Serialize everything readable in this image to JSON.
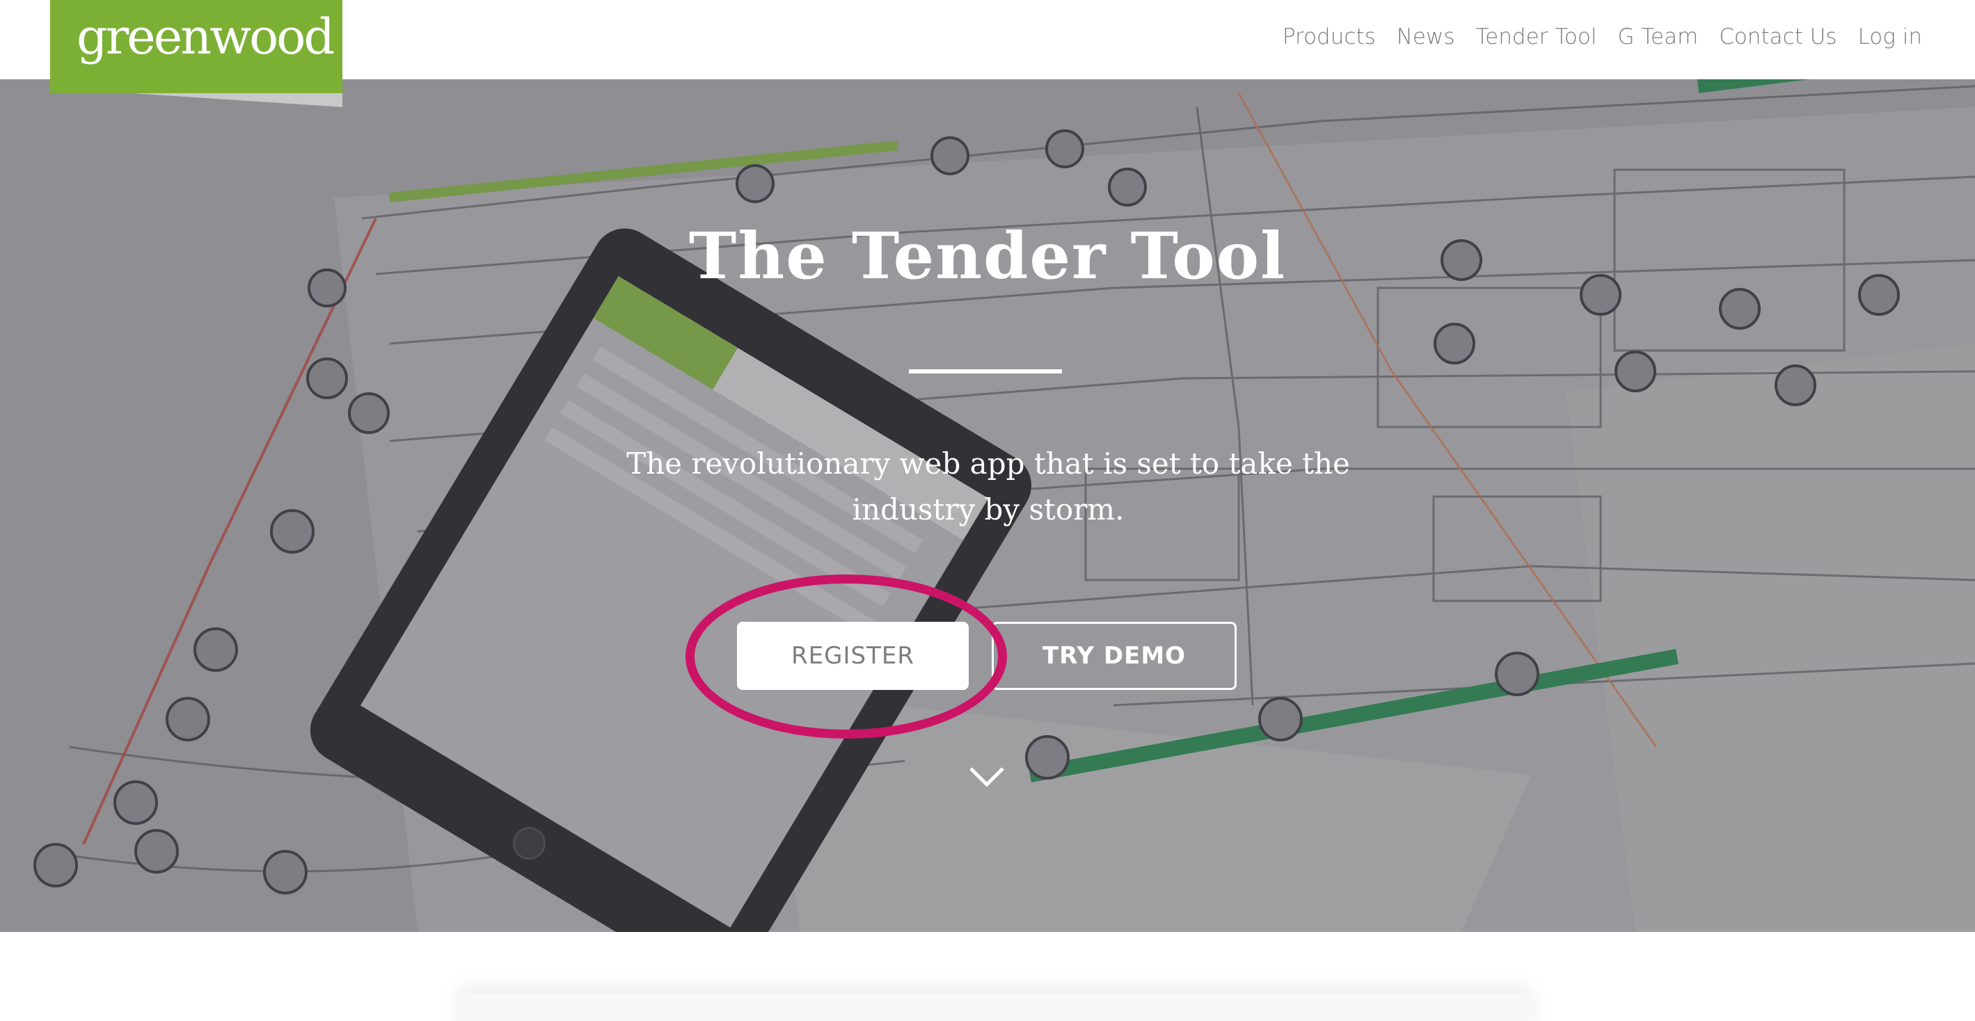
{
  "brand": {
    "logo_text": "greenwood",
    "color": "#7cb035"
  },
  "nav": {
    "items": [
      {
        "label": "Products"
      },
      {
        "label": "News"
      },
      {
        "label": "Tender Tool"
      },
      {
        "label": "G Team"
      },
      {
        "label": "Contact Us"
      },
      {
        "label": "Log in"
      }
    ]
  },
  "hero": {
    "title": "The Tender Tool",
    "subtitle": "The revolutionary web app that is set to take the industry by storm.",
    "register_label": "REGISTER",
    "demo_label": "TRY DEMO",
    "scroll_icon": "chevron-down-icon",
    "highlight_color": "#cc1466"
  }
}
